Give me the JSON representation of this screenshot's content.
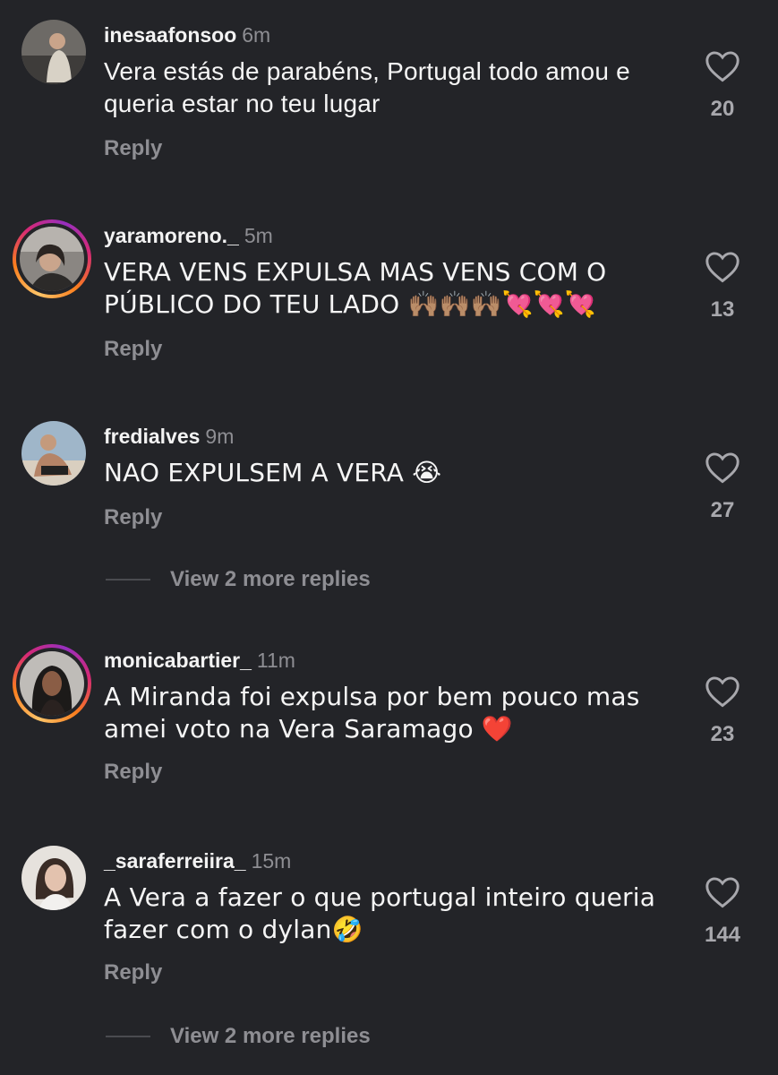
{
  "comments": [
    {
      "username": "inesaafonsoo",
      "time": "6m",
      "text": "Vera estás de parabéns, Portugal todo amou e queria estar no teu lugar",
      "likes": "20",
      "reply_label": "Reply"
    },
    {
      "username": "yaramoreno._",
      "time": "5m",
      "text": "VERA VENS EXPULSA MAS VENS COM O PÚBLICO DO TEU LADO 🙌🏽🙌🏽🙌🏽💘💘💘",
      "likes": "13",
      "reply_label": "Reply"
    },
    {
      "username": "fredialves",
      "time": "9m",
      "text": "NAO EXPULSEM A VERA 😭",
      "likes": "27",
      "reply_label": "Reply",
      "view_more": "View 2 more replies"
    },
    {
      "username": "monicabartier_",
      "time": "11m",
      "text": "A Miranda foi expulsa por bem pouco mas amei voto na Vera Saramago ❤️",
      "likes": "23",
      "reply_label": "Reply"
    },
    {
      "username": "_saraferreiira_",
      "time": "15m",
      "text": "A Vera a fazer o que portugal inteiro queria fazer com o dylan🤣",
      "likes": "144",
      "reply_label": "Reply",
      "view_more": "View 2 more replies"
    }
  ],
  "icons": {
    "like": "heart-outline-icon"
  },
  "colors": {
    "background": "#232428",
    "secondary_text": "#8e8e93",
    "story_ring": "#d62976"
  }
}
